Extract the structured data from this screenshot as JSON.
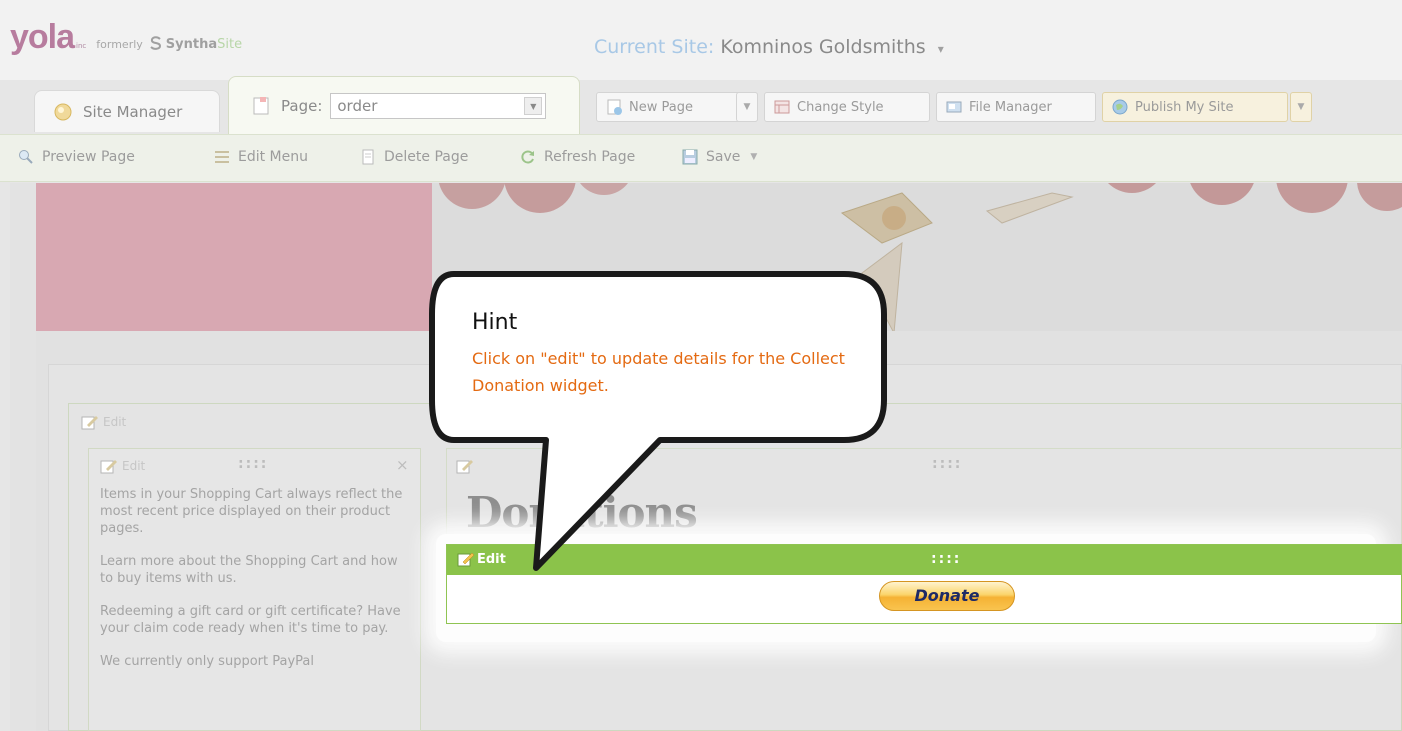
{
  "branding": {
    "logo": "yola",
    "logo_suffix": "inc",
    "formerly": "formerly",
    "former_name_a": "Syntha",
    "former_name_b": "Site"
  },
  "current_site": {
    "label": "Current Site:",
    "name": "Komninos Goldsmiths"
  },
  "tabs": {
    "site_manager": "Site Manager",
    "page_label": "Page:",
    "page_value": "order"
  },
  "toolbar": {
    "new_page": "New Page",
    "change_style": "Change Style",
    "file_manager": "File Manager",
    "publish": "Publish My Site"
  },
  "page_toolbar": {
    "preview": "Preview Page",
    "edit_menu": "Edit Menu",
    "delete": "Delete Page",
    "refresh": "Refresh Page",
    "save": "Save"
  },
  "editor": {
    "edit_label": "Edit",
    "grip": "::::",
    "close": "×",
    "shopping_text": [
      "Items in your Shopping Cart always reflect the most recent price displayed on their product pages.",
      "Learn more about the Shopping Cart and how to buy items with us.",
      "Redeeming a gift card or gift certificate? Have your claim code ready when it's time to pay.",
      "We currently only support PayPal"
    ],
    "heading": "Donations",
    "donate_button": "Donate"
  },
  "hint": {
    "title": "Hint",
    "body": "Click on \"edit\" to update details for the Collect Donation widget."
  },
  "colors": {
    "accent_green": "#8bc34a",
    "hint_orange": "#e46a12",
    "brand_pink": "#b77c9e"
  }
}
